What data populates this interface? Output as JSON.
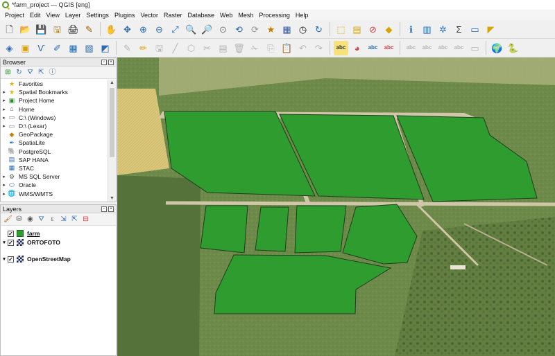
{
  "window": {
    "title": "*farm_project — QGIS [eng]"
  },
  "menu": [
    "Project",
    "Edit",
    "View",
    "Layer",
    "Settings",
    "Plugins",
    "Vector",
    "Raster",
    "Database",
    "Web",
    "Mesh",
    "Processing",
    "Help"
  ],
  "toolbar_labels": {
    "abc1": "abc",
    "abc2": "abc",
    "abc3": "abc",
    "abc4": "abc",
    "abc5": "abc",
    "abc6": "abc",
    "abc7": "abc",
    "sigma": "Σ"
  },
  "browser": {
    "title": "Browser",
    "items": [
      {
        "label": "Favorites",
        "icon": "star-icon"
      },
      {
        "label": "Spatial Bookmarks",
        "icon": "bookmark-icon"
      },
      {
        "label": "Project Home",
        "icon": "project-home-icon"
      },
      {
        "label": "Home",
        "icon": "home-icon"
      },
      {
        "label": "C:\\ (Windows)",
        "icon": "drive-icon"
      },
      {
        "label": "D:\\ (Lexar)",
        "icon": "drive-icon"
      },
      {
        "label": "GeoPackage",
        "icon": "geopackage-icon"
      },
      {
        "label": "SpatiaLite",
        "icon": "spatialite-icon"
      },
      {
        "label": "PostgreSQL",
        "icon": "postgresql-icon"
      },
      {
        "label": "SAP HANA",
        "icon": "sap-hana-icon"
      },
      {
        "label": "STAC",
        "icon": "stac-icon"
      },
      {
        "label": "MS SQL Server",
        "icon": "mssql-icon"
      },
      {
        "label": "Oracle",
        "icon": "oracle-icon"
      },
      {
        "label": "WMS/WMTS",
        "icon": "wms-icon"
      }
    ]
  },
  "layers": {
    "title": "Layers",
    "items": [
      {
        "name": "farm",
        "visible": true,
        "type": "vector"
      },
      {
        "name": "ORTOFOTO",
        "visible": true,
        "type": "raster"
      },
      {
        "name": "OpenStreetMap",
        "visible": true,
        "type": "raster"
      }
    ]
  },
  "colors": {
    "field_fill": "#2e9c2e",
    "field_stroke": "#1f3d1f",
    "accent": "#5a9a2a"
  }
}
